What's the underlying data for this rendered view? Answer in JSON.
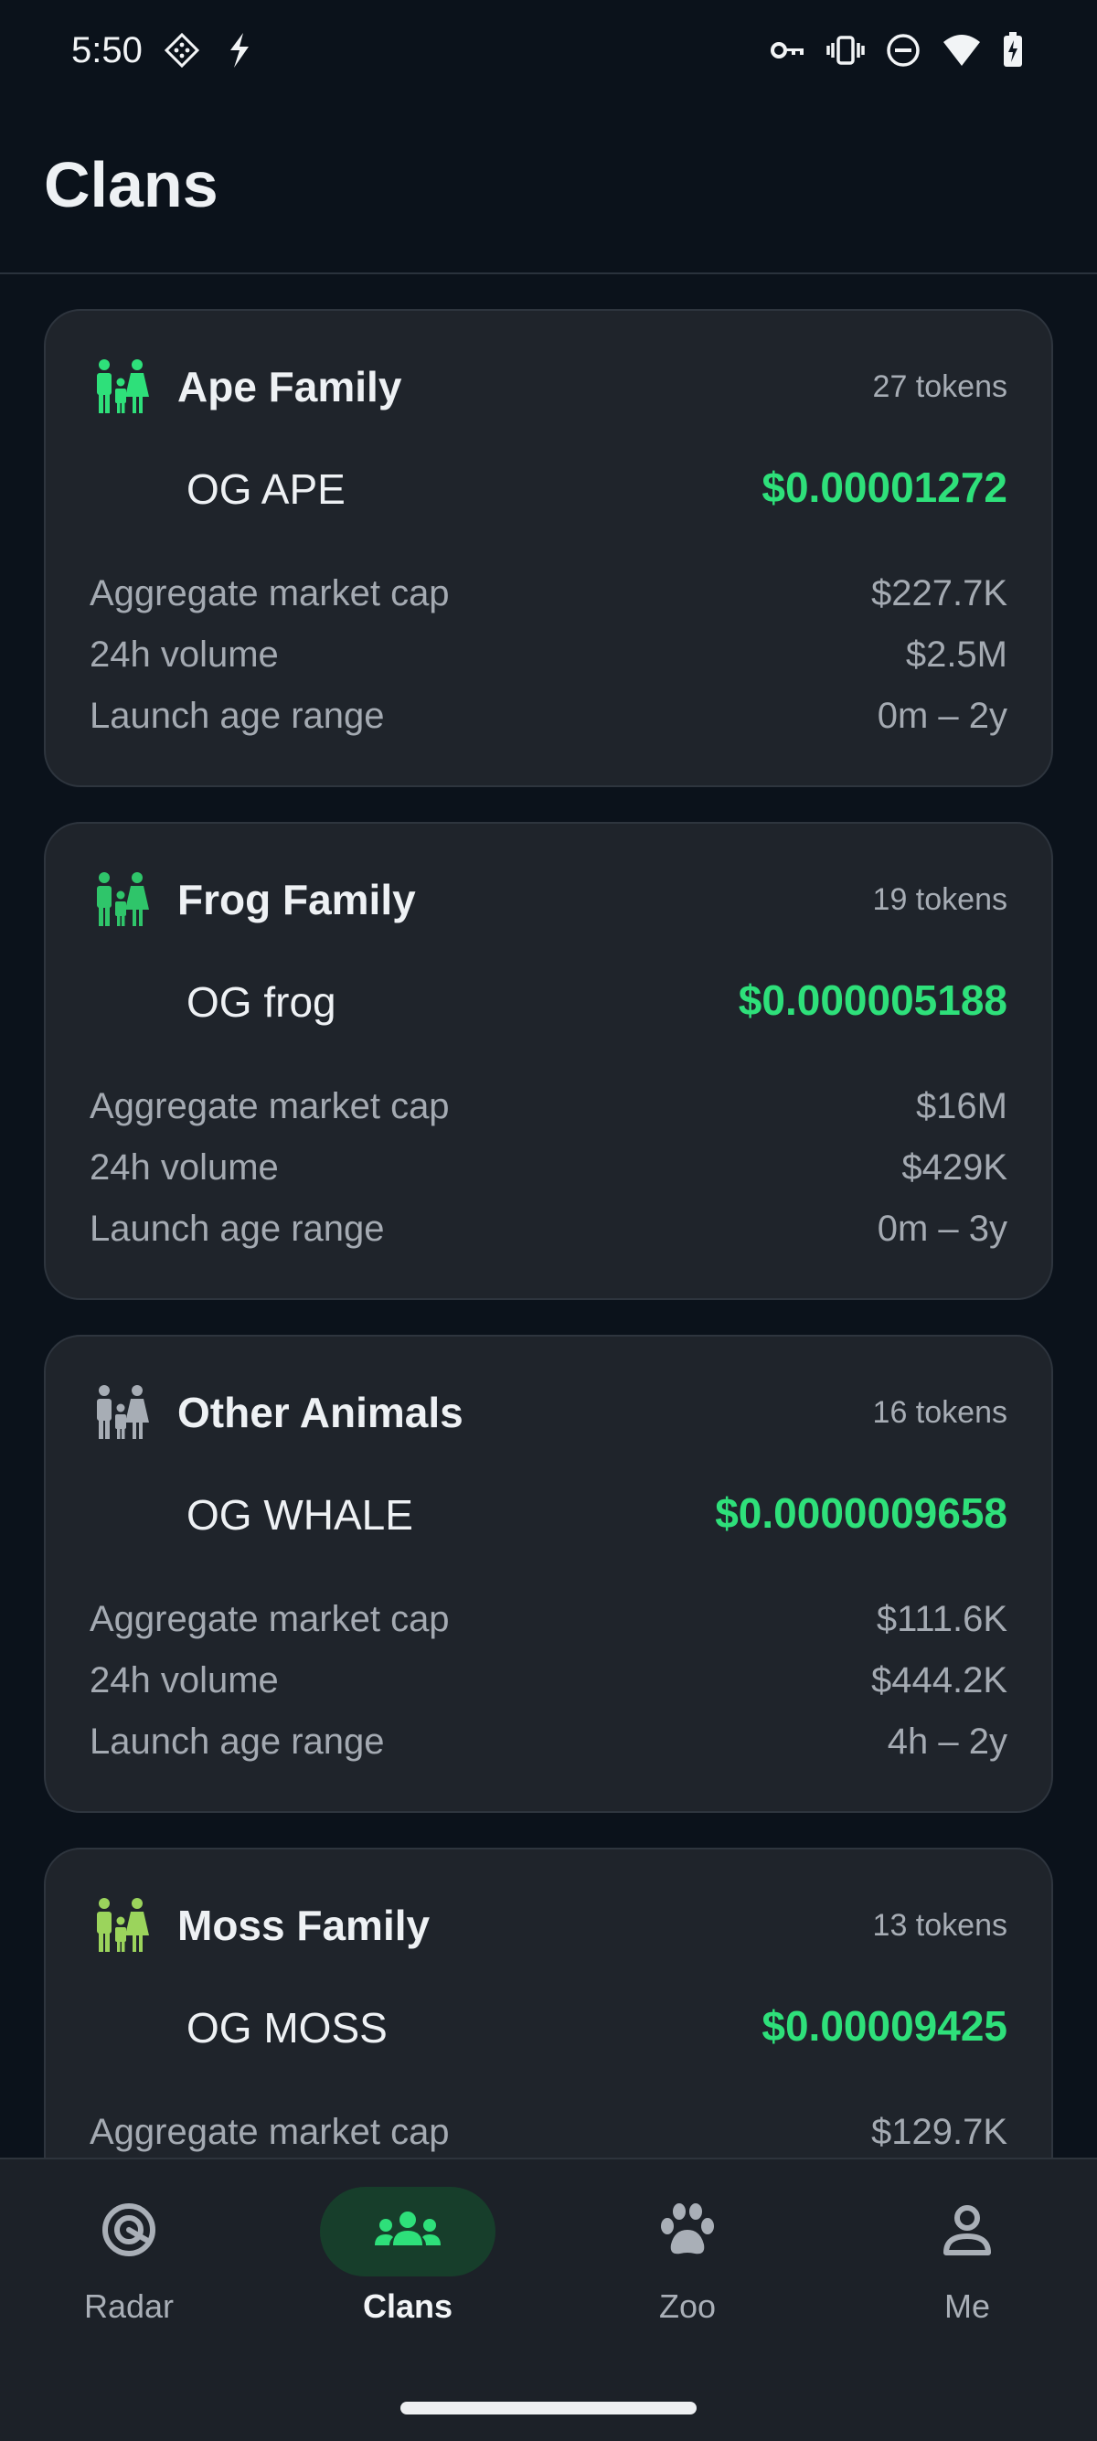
{
  "status_bar": {
    "time": "5:50",
    "icons": [
      "game-controller-icon",
      "flash-icon",
      "vpn-key-icon",
      "vibrate-icon",
      "do-not-disturb-icon",
      "wifi-icon",
      "battery-charging-icon"
    ]
  },
  "header": {
    "title": "Clans"
  },
  "clans": [
    {
      "name": "Ape Family",
      "token_count": "27 tokens",
      "icon_color": "#2ee07a",
      "og_name": "OG APE",
      "og_price": "$0.00001272",
      "stats": [
        {
          "label": "Aggregate market cap",
          "value": "$227.7K"
        },
        {
          "label": "24h volume",
          "value": "$2.5M"
        },
        {
          "label": "Launch age range",
          "value": "0m – 2y"
        }
      ]
    },
    {
      "name": "Frog Family",
      "token_count": "19 tokens",
      "icon_color": "#2fc56a",
      "og_name": "OG frog",
      "og_price": "$0.000005188",
      "stats": [
        {
          "label": "Aggregate market cap",
          "value": "$16M"
        },
        {
          "label": "24h volume",
          "value": "$429K"
        },
        {
          "label": "Launch age range",
          "value": "0m – 3y"
        }
      ]
    },
    {
      "name": "Other Animals",
      "token_count": "16 tokens",
      "icon_color": "#a7adb5",
      "og_name": "OG WHALE",
      "og_price": "$0.0000009658",
      "stats": [
        {
          "label": "Aggregate market cap",
          "value": "$111.6K"
        },
        {
          "label": "24h volume",
          "value": "$444.2K"
        },
        {
          "label": "Launch age range",
          "value": "4h – 2y"
        }
      ]
    },
    {
      "name": "Moss Family",
      "token_count": "13 tokens",
      "icon_color": "#9bd45c",
      "og_name": "OG MOSS",
      "og_price": "$0.00009425",
      "stats": [
        {
          "label": "Aggregate market cap",
          "value": "$129.7K"
        }
      ]
    }
  ],
  "bottom_nav": {
    "active": "Clans",
    "items": [
      {
        "label": "Radar",
        "icon": "radar-icon"
      },
      {
        "label": "Clans",
        "icon": "group-icon"
      },
      {
        "label": "Zoo",
        "icon": "paw-icon"
      },
      {
        "label": "Me",
        "icon": "person-icon"
      }
    ]
  },
  "colors": {
    "background": "#0b121b",
    "card": "#1f242b",
    "price_green": "#2ee07a",
    "active_pill": "#173e2b"
  }
}
